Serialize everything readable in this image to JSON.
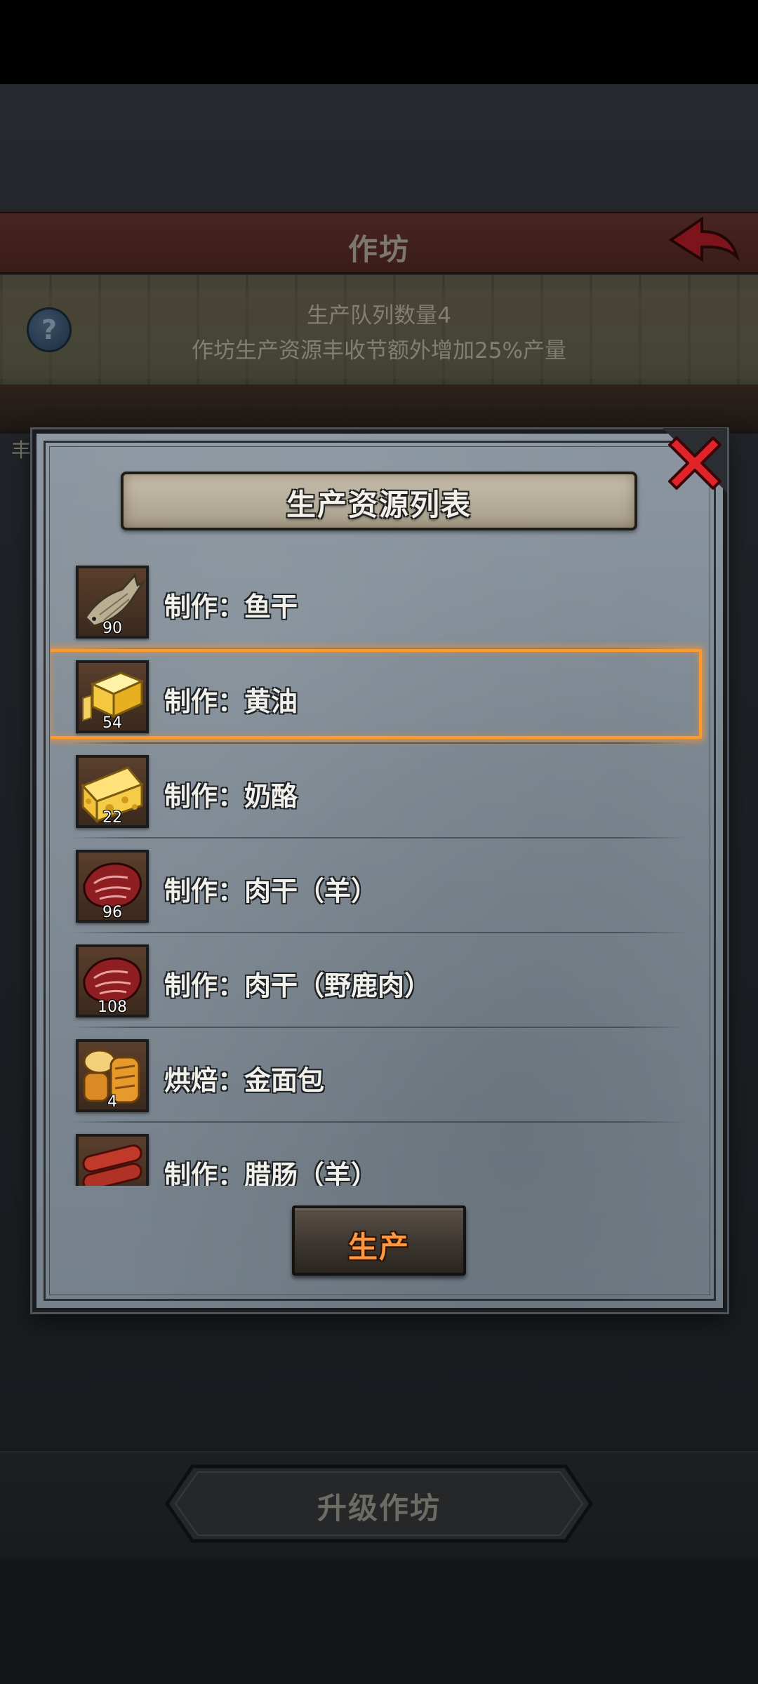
{
  "background": {
    "header_title": "作坊",
    "info_line1": "生产队列数量4",
    "info_line2": "作坊生产资源丰收节额外增加25%产量",
    "help_icon_glyph": "?",
    "side_text": "丰",
    "upgrade_button_label": "升级作坊"
  },
  "modal": {
    "title": "生产资源列表",
    "produce_button_label": "生产",
    "selected_index": 1,
    "items": [
      {
        "label": "制作：鱼干",
        "count": "90",
        "icon": "dried-fish-icon"
      },
      {
        "label": "制作：黄油",
        "count": "54",
        "icon": "butter-icon"
      },
      {
        "label": "制作：奶酪",
        "count": "22",
        "icon": "cheese-icon"
      },
      {
        "label": "制作：肉干（羊）",
        "count": "96",
        "icon": "jerky-mutton-icon"
      },
      {
        "label": "制作：肉干（野鹿肉）",
        "count": "108",
        "icon": "jerky-venison-icon"
      },
      {
        "label": "烘焙：金面包",
        "count": "4",
        "icon": "golden-bread-icon"
      },
      {
        "label": "制作：腊肠（羊）",
        "count": "",
        "icon": "sausage-icon"
      }
    ]
  },
  "colors": {
    "highlight": "#ff9a2a",
    "produce_text": "#ff9640",
    "close_x": "#e0242a",
    "back_arrow": "#c0202a"
  }
}
